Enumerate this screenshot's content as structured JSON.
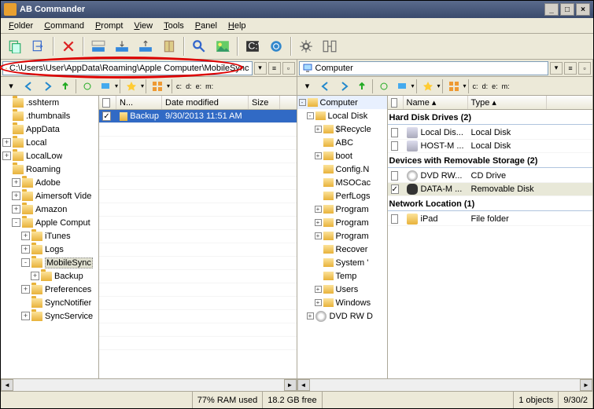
{
  "title": "AB Commander",
  "menu": [
    "Folder",
    "Command",
    "Prompt",
    "View",
    "Tools",
    "Panel",
    "Help"
  ],
  "left": {
    "path": "C:\\Users\\User\\AppData\\Roaming\\Apple Computer\\MobileSync",
    "tree": [
      {
        "l": ".sshterm",
        "d": 0,
        "e": ""
      },
      {
        "l": ".thumbnails",
        "d": 0,
        "e": ""
      },
      {
        "l": "AppData",
        "d": 0,
        "e": ""
      },
      {
        "l": "Local",
        "d": 0,
        "e": "+"
      },
      {
        "l": "LocalLow",
        "d": 0,
        "e": "+"
      },
      {
        "l": "Roaming",
        "d": 0,
        "e": ""
      },
      {
        "l": "Adobe",
        "d": 1,
        "e": "+"
      },
      {
        "l": "Aimersoft Vide",
        "d": 1,
        "e": "+"
      },
      {
        "l": "Amazon",
        "d": 1,
        "e": "+"
      },
      {
        "l": "Apple Comput",
        "d": 1,
        "e": "-"
      },
      {
        "l": "iTunes",
        "d": 2,
        "e": "+"
      },
      {
        "l": "Logs",
        "d": 2,
        "e": "+"
      },
      {
        "l": "MobileSync",
        "d": 2,
        "e": "-",
        "sel": true
      },
      {
        "l": "Backup",
        "d": 3,
        "e": "+"
      },
      {
        "l": "Preferences",
        "d": 2,
        "e": "+"
      },
      {
        "l": "SyncNotifier",
        "d": 2,
        "e": ""
      },
      {
        "l": "SyncService",
        "d": 2,
        "e": "+"
      }
    ],
    "cols": [
      {
        "t": "",
        "w": 22
      },
      {
        "t": "N...",
        "w": 58
      },
      {
        "t": "Date modified",
        "w": 110
      },
      {
        "t": "Size",
        "w": 40
      }
    ],
    "rows": [
      {
        "chk": true,
        "name": "Backup",
        "date": "9/30/2013 11:51 AM",
        "size": ""
      }
    ]
  },
  "right": {
    "path": "Computer",
    "tree": [
      {
        "l": "Computer",
        "d": 0,
        "e": "-",
        "top": true
      },
      {
        "l": "Local Disk",
        "d": 1,
        "e": "-"
      },
      {
        "l": "$Recycle",
        "d": 2,
        "e": "+"
      },
      {
        "l": "ABC",
        "d": 2,
        "e": ""
      },
      {
        "l": "boot",
        "d": 2,
        "e": "+"
      },
      {
        "l": "Config.N",
        "d": 2,
        "e": ""
      },
      {
        "l": "MSOCac",
        "d": 2,
        "e": ""
      },
      {
        "l": "PerfLogs",
        "d": 2,
        "e": ""
      },
      {
        "l": "Program",
        "d": 2,
        "e": "+"
      },
      {
        "l": "Program",
        "d": 2,
        "e": "+"
      },
      {
        "l": "Program",
        "d": 2,
        "e": "+"
      },
      {
        "l": "Recover",
        "d": 2,
        "e": ""
      },
      {
        "l": "System '",
        "d": 2,
        "e": ""
      },
      {
        "l": "Temp",
        "d": 2,
        "e": ""
      },
      {
        "l": "Users",
        "d": 2,
        "e": "+"
      },
      {
        "l": "Windows",
        "d": 2,
        "e": "+"
      },
      {
        "l": "DVD RW D",
        "d": 1,
        "e": "+",
        "drv": true
      }
    ],
    "cols": [
      {
        "t": "",
        "w": 20
      },
      {
        "t": "Name",
        "w": 82
      },
      {
        "t": "Type",
        "w": 100
      }
    ],
    "groups": [
      {
        "title": "Hard Disk Drives (2)",
        "items": [
          {
            "chk": false,
            "icon": "disk",
            "name": "Local Dis...",
            "type": "Local Disk"
          },
          {
            "chk": false,
            "icon": "disk",
            "name": "HOST-M ...",
            "type": "Local Disk"
          }
        ]
      },
      {
        "title": "Devices with Removable Storage (2)",
        "items": [
          {
            "chk": false,
            "icon": "cd",
            "name": "DVD RW...",
            "type": "CD Drive"
          },
          {
            "chk": true,
            "icon": "usb",
            "name": "DATA-M ...",
            "type": "Removable Disk",
            "sel": true
          }
        ]
      },
      {
        "title": "Network Location (1)",
        "items": [
          {
            "chk": false,
            "icon": "ffolder",
            "name": "iPad",
            "type": "File folder"
          }
        ]
      }
    ]
  },
  "status": {
    "ram": "77% RAM used",
    "free": "18.2 GB free",
    "objects": "1 objects",
    "date": "9/30/2"
  }
}
